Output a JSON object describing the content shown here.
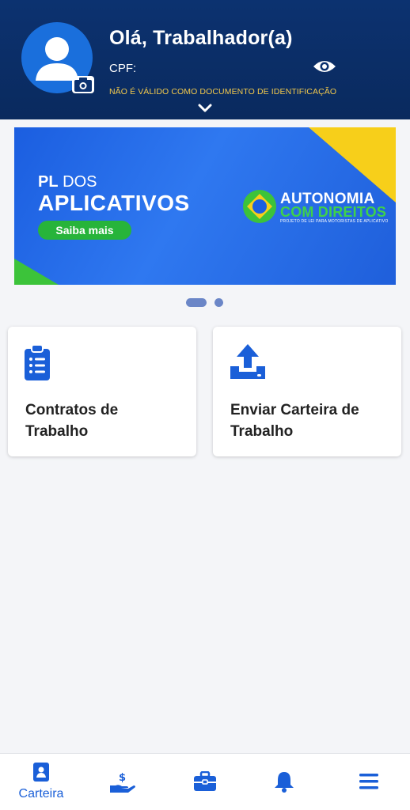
{
  "header": {
    "greeting": "Olá, Trabalhador(a)",
    "cpf_label": "CPF:",
    "disclaimer": "NÃO É VÁLIDO COMO DOCUMENTO DE IDENTIFICAÇÃO",
    "icons": [
      "avatar-icon",
      "camera-icon",
      "eye-icon",
      "chevron-down-icon"
    ]
  },
  "banner": {
    "line1_bold": "PL",
    "line1_rest": " DOS",
    "line2": "APLICATIVOS",
    "cta": "Saiba mais",
    "brand_line1": "AUTONOMIA",
    "brand_line2": "COM DIREITOS",
    "brand_sub": "PROJETO DE LEI PARA MOTORISTAS DE APLICATIVO"
  },
  "carousel": {
    "count": 2,
    "active": 1
  },
  "cards": [
    {
      "title": "Contratos de Trabalho",
      "icon": "clipboard-list-icon"
    },
    {
      "title": "Enviar Carteira de Trabalho",
      "icon": "upload-tray-icon"
    }
  ],
  "bottom_nav": {
    "items": [
      {
        "label": "Carteira",
        "icon": "wallet-id-icon",
        "active": true
      },
      {
        "label": "",
        "icon": "hand-money-icon",
        "active": false
      },
      {
        "label": "",
        "icon": "briefcase-icon",
        "active": false
      },
      {
        "label": "",
        "icon": "bell-icon",
        "active": false
      },
      {
        "label": "",
        "icon": "menu-icon",
        "active": false
      }
    ]
  },
  "colors": {
    "header_bg": "#0c3270",
    "accent_blue": "#1a5fd8",
    "disclaimer_yellow": "#f2c94c",
    "cta_green": "#27b43a"
  }
}
